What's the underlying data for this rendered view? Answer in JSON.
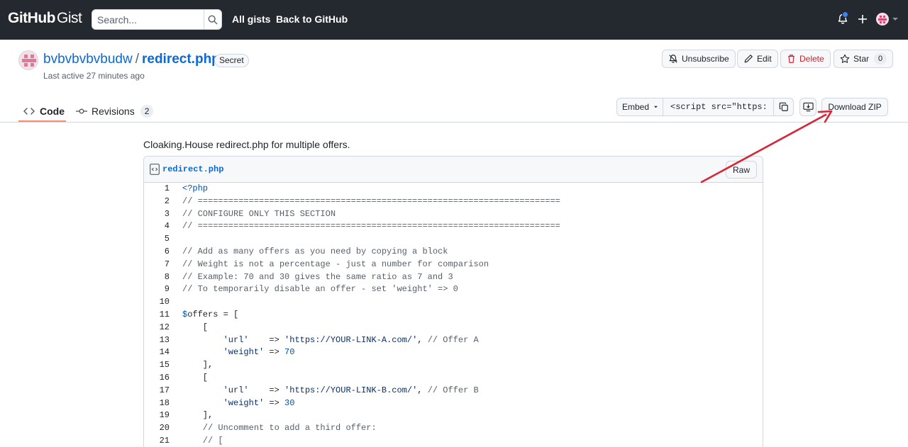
{
  "header": {
    "logo_main": "GitHub",
    "logo_sub": "Gist",
    "search_placeholder": "Search...",
    "nav": [
      "All gists",
      "Back to GitHub"
    ],
    "icons": [
      "search-icon",
      "bell-icon",
      "plus-icon",
      "avatar-icon",
      "caret-down-icon"
    ]
  },
  "gist": {
    "owner": "bvbvbvbvbudw",
    "separator": "/",
    "filename": "redirect.php",
    "badge": "Secret",
    "last_active": "Last active 27 minutes ago",
    "actions": {
      "unsubscribe": "Unsubscribe",
      "edit": "Edit",
      "delete": "Delete",
      "star": "Star",
      "star_count": "0"
    },
    "tabs": {
      "code": "Code",
      "revisions": "Revisions",
      "revisions_count": "2"
    },
    "embed": {
      "label": "Embed",
      "value": "<script src=\"https://gist.github.com/bvbvbvbvbudw"
    },
    "download_zip": "Download ZIP",
    "description": "Cloaking.House redirect.php for multiple offers."
  },
  "file": {
    "name": "redirect.php",
    "raw_label": "Raw",
    "lines": [
      [
        {
          "t": "<?php",
          "c": "k"
        }
      ],
      [
        {
          "t": "// =======================================================================",
          "c": "c"
        }
      ],
      [
        {
          "t": "// CONFIGURE ONLY THIS SECTION",
          "c": "c"
        }
      ],
      [
        {
          "t": "// =======================================================================",
          "c": "c"
        }
      ],
      [],
      [
        {
          "t": "// Add as many offers as you need by copying a block",
          "c": "c"
        }
      ],
      [
        {
          "t": "// Weight is not a percentage - just a number for comparison",
          "c": "c"
        }
      ],
      [
        {
          "t": "// Example: 70 and 30 gives the same ratio as 7 and 3",
          "c": "c"
        }
      ],
      [
        {
          "t": "// To temporarily disable an offer - set 'weight' => 0",
          "c": "c"
        }
      ],
      [],
      [
        {
          "t": "$",
          "c": "k"
        },
        {
          "t": "offers = [",
          "c": "p"
        }
      ],
      [
        {
          "t": "    [",
          "c": "p"
        }
      ],
      [
        {
          "t": "        ",
          "c": "p"
        },
        {
          "t": "'url'",
          "c": "s"
        },
        {
          "t": "    => ",
          "c": "p"
        },
        {
          "t": "'https://YOUR-LINK-A.com/'",
          "c": "s"
        },
        {
          "t": ", ",
          "c": "p"
        },
        {
          "t": "// Offer A",
          "c": "c"
        }
      ],
      [
        {
          "t": "        ",
          "c": "p"
        },
        {
          "t": "'weight'",
          "c": "s"
        },
        {
          "t": " => ",
          "c": "p"
        },
        {
          "t": "70",
          "c": "k"
        }
      ],
      [
        {
          "t": "    ],",
          "c": "p"
        }
      ],
      [
        {
          "t": "    [",
          "c": "p"
        }
      ],
      [
        {
          "t": "        ",
          "c": "p"
        },
        {
          "t": "'url'",
          "c": "s"
        },
        {
          "t": "    => ",
          "c": "p"
        },
        {
          "t": "'https://YOUR-LINK-B.com/'",
          "c": "s"
        },
        {
          "t": ", ",
          "c": "p"
        },
        {
          "t": "// Offer B",
          "c": "c"
        }
      ],
      [
        {
          "t": "        ",
          "c": "p"
        },
        {
          "t": "'weight'",
          "c": "s"
        },
        {
          "t": " => ",
          "c": "p"
        },
        {
          "t": "30",
          "c": "k"
        }
      ],
      [
        {
          "t": "    ],",
          "c": "p"
        }
      ],
      [
        {
          "t": "    // Uncomment to add a third offer:",
          "c": "c"
        }
      ],
      [
        {
          "t": "    // [",
          "c": "c"
        }
      ]
    ]
  },
  "colors": {
    "header_bg": "#24292f",
    "link": "#0969da",
    "danger": "#cf222e",
    "tab_underline": "#fd8c73",
    "annotation_arrow": "#d72638"
  }
}
